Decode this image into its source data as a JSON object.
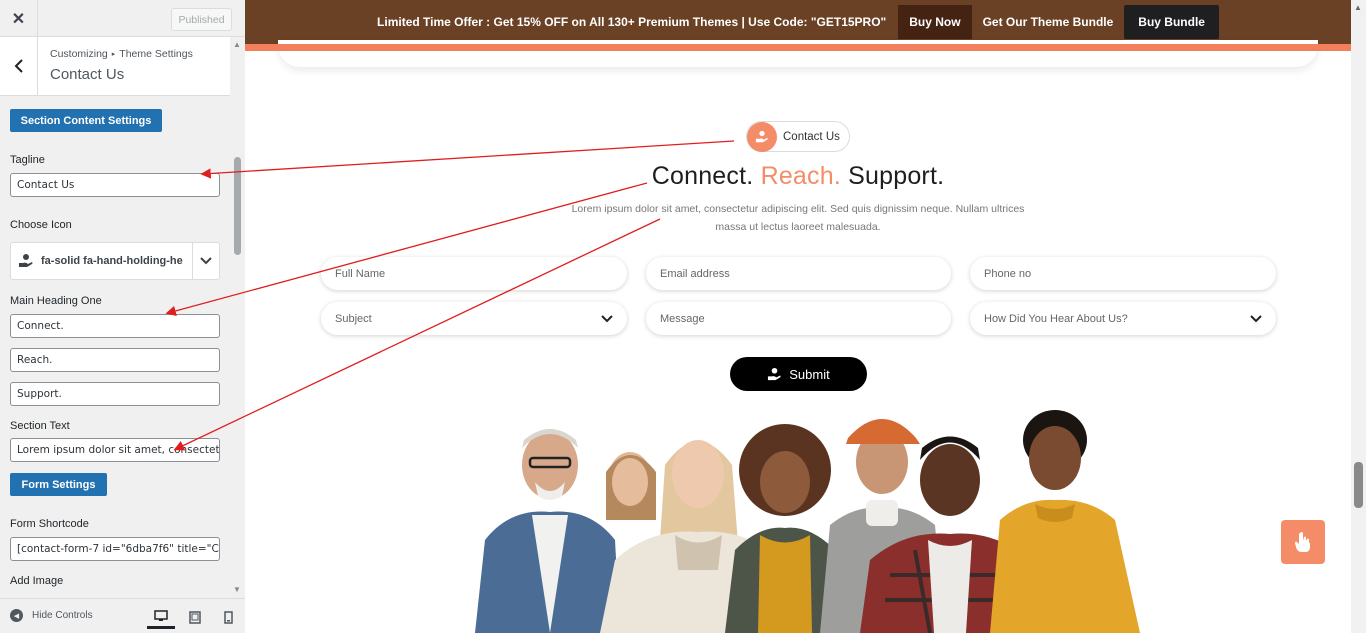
{
  "topbar": {
    "close_icon": "close-icon",
    "publish_label": "Published"
  },
  "header": {
    "breadcrumb_root": "Customizing",
    "breadcrumb_section": "Theme Settings",
    "title": "Contact Us"
  },
  "controls": {
    "section_content_button": "Section Content Settings",
    "tagline_label": "Tagline",
    "tagline_value": "Contact Us",
    "icon_label": "Choose Icon",
    "icon_value": "fa-solid fa-hand-holding-he",
    "heading_label": "Main Heading One",
    "heading_one": "Connect.",
    "heading_two": "Reach.",
    "heading_three": "Support.",
    "section_text_label": "Section Text",
    "section_text_value": "Lorem ipsum dolor sit amet, consectetu",
    "form_settings_button": "Form Settings",
    "shortcode_label": "Form Shortcode",
    "shortcode_value": "[contact-form-7 id=\"6dba7f6\" title=\"Co",
    "add_image_label": "Add Image"
  },
  "footer": {
    "hide_controls": "Hide Controls",
    "devices": [
      "desktop",
      "tablet",
      "mobile"
    ],
    "active_device": "desktop"
  },
  "promo": {
    "text": "Limited Time Offer : Get 15% OFF on All 130+ Premium Themes | Use Code: \"GET15PRO\"",
    "buy_now": "Buy Now",
    "bundle_text": "Get Our Theme Bundle",
    "buy_bundle": "Buy Bundle"
  },
  "section": {
    "tagline": "Contact Us",
    "heading_one": "Connect.",
    "heading_two": "Reach.",
    "heading_three": "Support.",
    "text_line1": "Lorem ipsum dolor sit amet, consectetur adipiscing elit. Sed quis dignissim neque. Nullam ultrices",
    "text_line2": "massa ut lectus laoreet malesuada."
  },
  "form": {
    "full_name": "Full Name",
    "email": "Email address",
    "phone": "Phone no",
    "subject": "Subject",
    "message": "Message",
    "hear_about": "How Did You Hear About Us?",
    "submit": "Submit"
  },
  "colors": {
    "accent": "#f48c68",
    "brand_dark": "#6b4125",
    "wp_blue": "#2271b1",
    "arrow": "#e01e1e"
  }
}
